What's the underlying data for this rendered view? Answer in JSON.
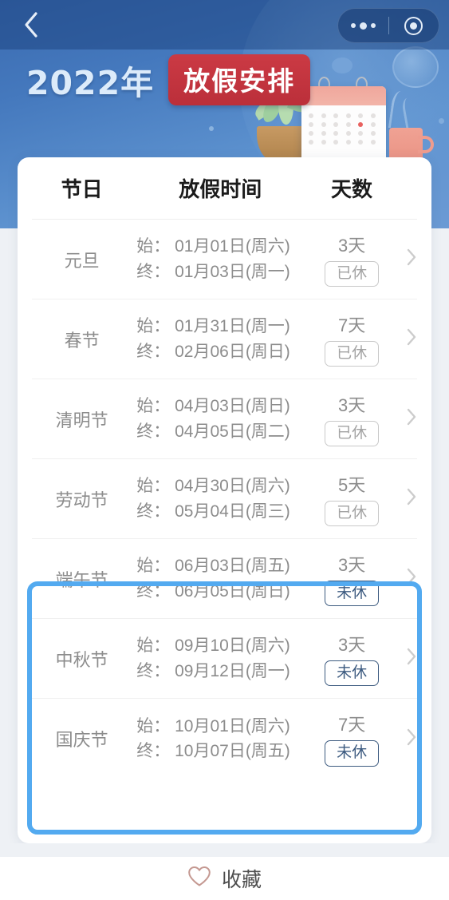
{
  "navbar": {
    "back_icon": "chevron-left-icon",
    "menu_icon": "more-dots-icon",
    "capsule_icon": "target-circle-icon"
  },
  "banner": {
    "year_text": "2022年",
    "badge_text": "放假安排",
    "badge_color": "#c5353f",
    "bg_color": "#4478bd",
    "illustration": [
      "calendar-illustration",
      "plant-illustration",
      "mug-illustration",
      "clock-illustration"
    ]
  },
  "table": {
    "headers": {
      "holiday": "节日",
      "period": "放假时间",
      "days": "天数"
    },
    "start_label": "始：",
    "end_label": "终：",
    "rows": [
      {
        "name": "元旦",
        "start": "始： 01月01日(周六)",
        "end": "终： 01月03日(周一)",
        "days": "3天",
        "status": "已休",
        "status_type": "done",
        "highlighted": false
      },
      {
        "name": "春节",
        "start": "始： 01月31日(周一)",
        "end": "终： 02月06日(周日)",
        "days": "7天",
        "status": "已休",
        "status_type": "done",
        "highlighted": false
      },
      {
        "name": "清明节",
        "start": "始： 04月03日(周日)",
        "end": "终： 04月05日(周二)",
        "days": "3天",
        "status": "已休",
        "status_type": "done",
        "highlighted": false
      },
      {
        "name": "劳动节",
        "start": "始： 04月30日(周六)",
        "end": "终： 05月04日(周三)",
        "days": "5天",
        "status": "已休",
        "status_type": "done",
        "highlighted": false
      },
      {
        "name": "端午节",
        "start": "始： 06月03日(周五)",
        "end": "终： 06月05日(周日)",
        "days": "3天",
        "status": "未休",
        "status_type": "todo",
        "highlighted": true
      },
      {
        "name": "中秋节",
        "start": "始： 09月10日(周六)",
        "end": "终： 09月12日(周一)",
        "days": "3天",
        "status": "未休",
        "status_type": "todo",
        "highlighted": true
      },
      {
        "name": "国庆节",
        "start": "始： 10月01日(周六)",
        "end": "终： 10月07日(周五)",
        "days": "7天",
        "status": "未休",
        "status_type": "todo",
        "highlighted": true
      }
    ],
    "row_arrow_icon": "chevron-right-icon",
    "highlight_color": "#53aaf0"
  },
  "footer": {
    "favorite_label": "收藏",
    "favorite_icon": "heart-outline-icon",
    "heart_color": "#c49891"
  }
}
